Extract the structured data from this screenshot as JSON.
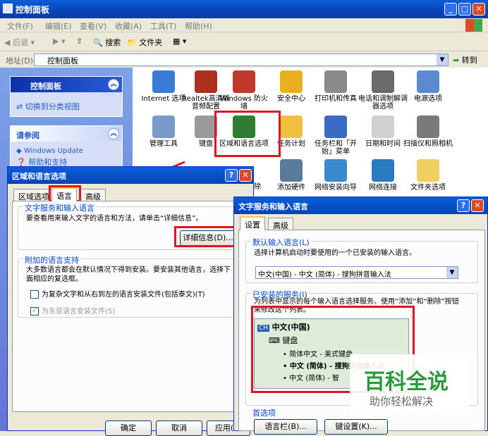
{
  "window": {
    "title": "控制面板",
    "btn_min": "_",
    "btn_max": "□",
    "btn_close": "✕"
  },
  "menu": [
    "文件(F)",
    "编辑(E)",
    "查看(V)",
    "收藏(A)",
    "工具(T)",
    "帮助(H)"
  ],
  "toolbar": {
    "back": "后退",
    "search": "搜索",
    "folders": "文件夹"
  },
  "address": {
    "label": "地址(D)",
    "value": "控制面板",
    "go": "转到"
  },
  "left": {
    "panel1_title": "控制面板",
    "switch_link": "切换到分类视图",
    "panel2_title": "请参阅",
    "windows_update": "Windows Update",
    "help": "帮助和支持"
  },
  "icons": [
    {
      "label": "Internet 选项",
      "color": "#3a7bd5"
    },
    {
      "label": "Realtek高清晰音频配置",
      "color": "#b03020"
    },
    {
      "label": "Windows 防火墙",
      "color": "#c0392b"
    },
    {
      "label": "安全中心",
      "color": "#e8b020"
    },
    {
      "label": "打印机和传真",
      "color": "#8a8a8a"
    },
    {
      "label": "电话和调制解调器选项",
      "color": "#6a6a6a"
    },
    {
      "label": "电源选项",
      "color": "#5a8ad0"
    },
    {
      "label": "管理工具",
      "color": "#7a9acb"
    },
    {
      "label": "键盘",
      "color": "#9a9a9a"
    },
    {
      "label": "区域和语言选项",
      "color": "#2e7d32"
    },
    {
      "label": "任务计划",
      "color": "#f0c040"
    },
    {
      "label": "任务栏和「开始」菜单",
      "color": "#3a6bc5"
    },
    {
      "label": "日期和时间",
      "color": "#d0d0d0"
    },
    {
      "label": "扫描仪和照相机",
      "color": "#7a7a7a"
    },
    {
      "label": "添加硬件",
      "color": "#5a7a9a"
    },
    {
      "label": "网络安装向导",
      "color": "#3a8ad0"
    },
    {
      "label": "网络连接",
      "color": "#2a7ac0"
    },
    {
      "label": "文件夹选项",
      "color": "#f0d060"
    }
  ],
  "dialog1": {
    "title": "区域和语言选项",
    "tabs": [
      "区域选项",
      "语言",
      "高级"
    ],
    "group1_title": "文字服务和输入语言",
    "group1_text": "要查看用来输入文字的语言和方法，请单击“详细信息”。",
    "details_btn": "详细信息(D)...",
    "group2_title": "附加的语言支持",
    "group2_text": "大多数语言都会在默认情况下得到安装。要安装其他语言，选择下面相应的复选框。",
    "check1": "为复杂文字和从右到左的语言安装文件(包括泰文)(T)",
    "check2": "为东亚语言安装文件(S)",
    "ok": "确定",
    "cancel": "取消",
    "apply": "应用(A)",
    "remove_frag": "除"
  },
  "dialog2": {
    "title": "文字服务和输入语言",
    "tabs": [
      "设置",
      "高级"
    ],
    "default_group": "默认输入语言(L)",
    "default_text": "选择计算机启动时要使用的一个已安装的输入语言。",
    "default_value": "中文(中国) - 中文 (简体) - 搜狗拼音输入法",
    "installed_group": "已安装的服务(I)",
    "installed_text": "为列表中显示的每个输入语言选择服务。使用“添加”和“删除”按钮来修改这个列表。",
    "tree": {
      "lang_badge": "CH",
      "lang": "中文(中国)",
      "keyboard": "键盘",
      "item1": "简体中文 - 美式键盘",
      "item2": "中文 (简体) - 搜狗拼音输入法",
      "item3": "中文 (简体) - 智"
    },
    "pref_group": "首选项",
    "langbar_btn": "语言栏(B)...",
    "keyset_btn": "键设置(K)..."
  },
  "watermark": {
    "title": "百科全说",
    "subtitle": "助你轻松解决"
  }
}
